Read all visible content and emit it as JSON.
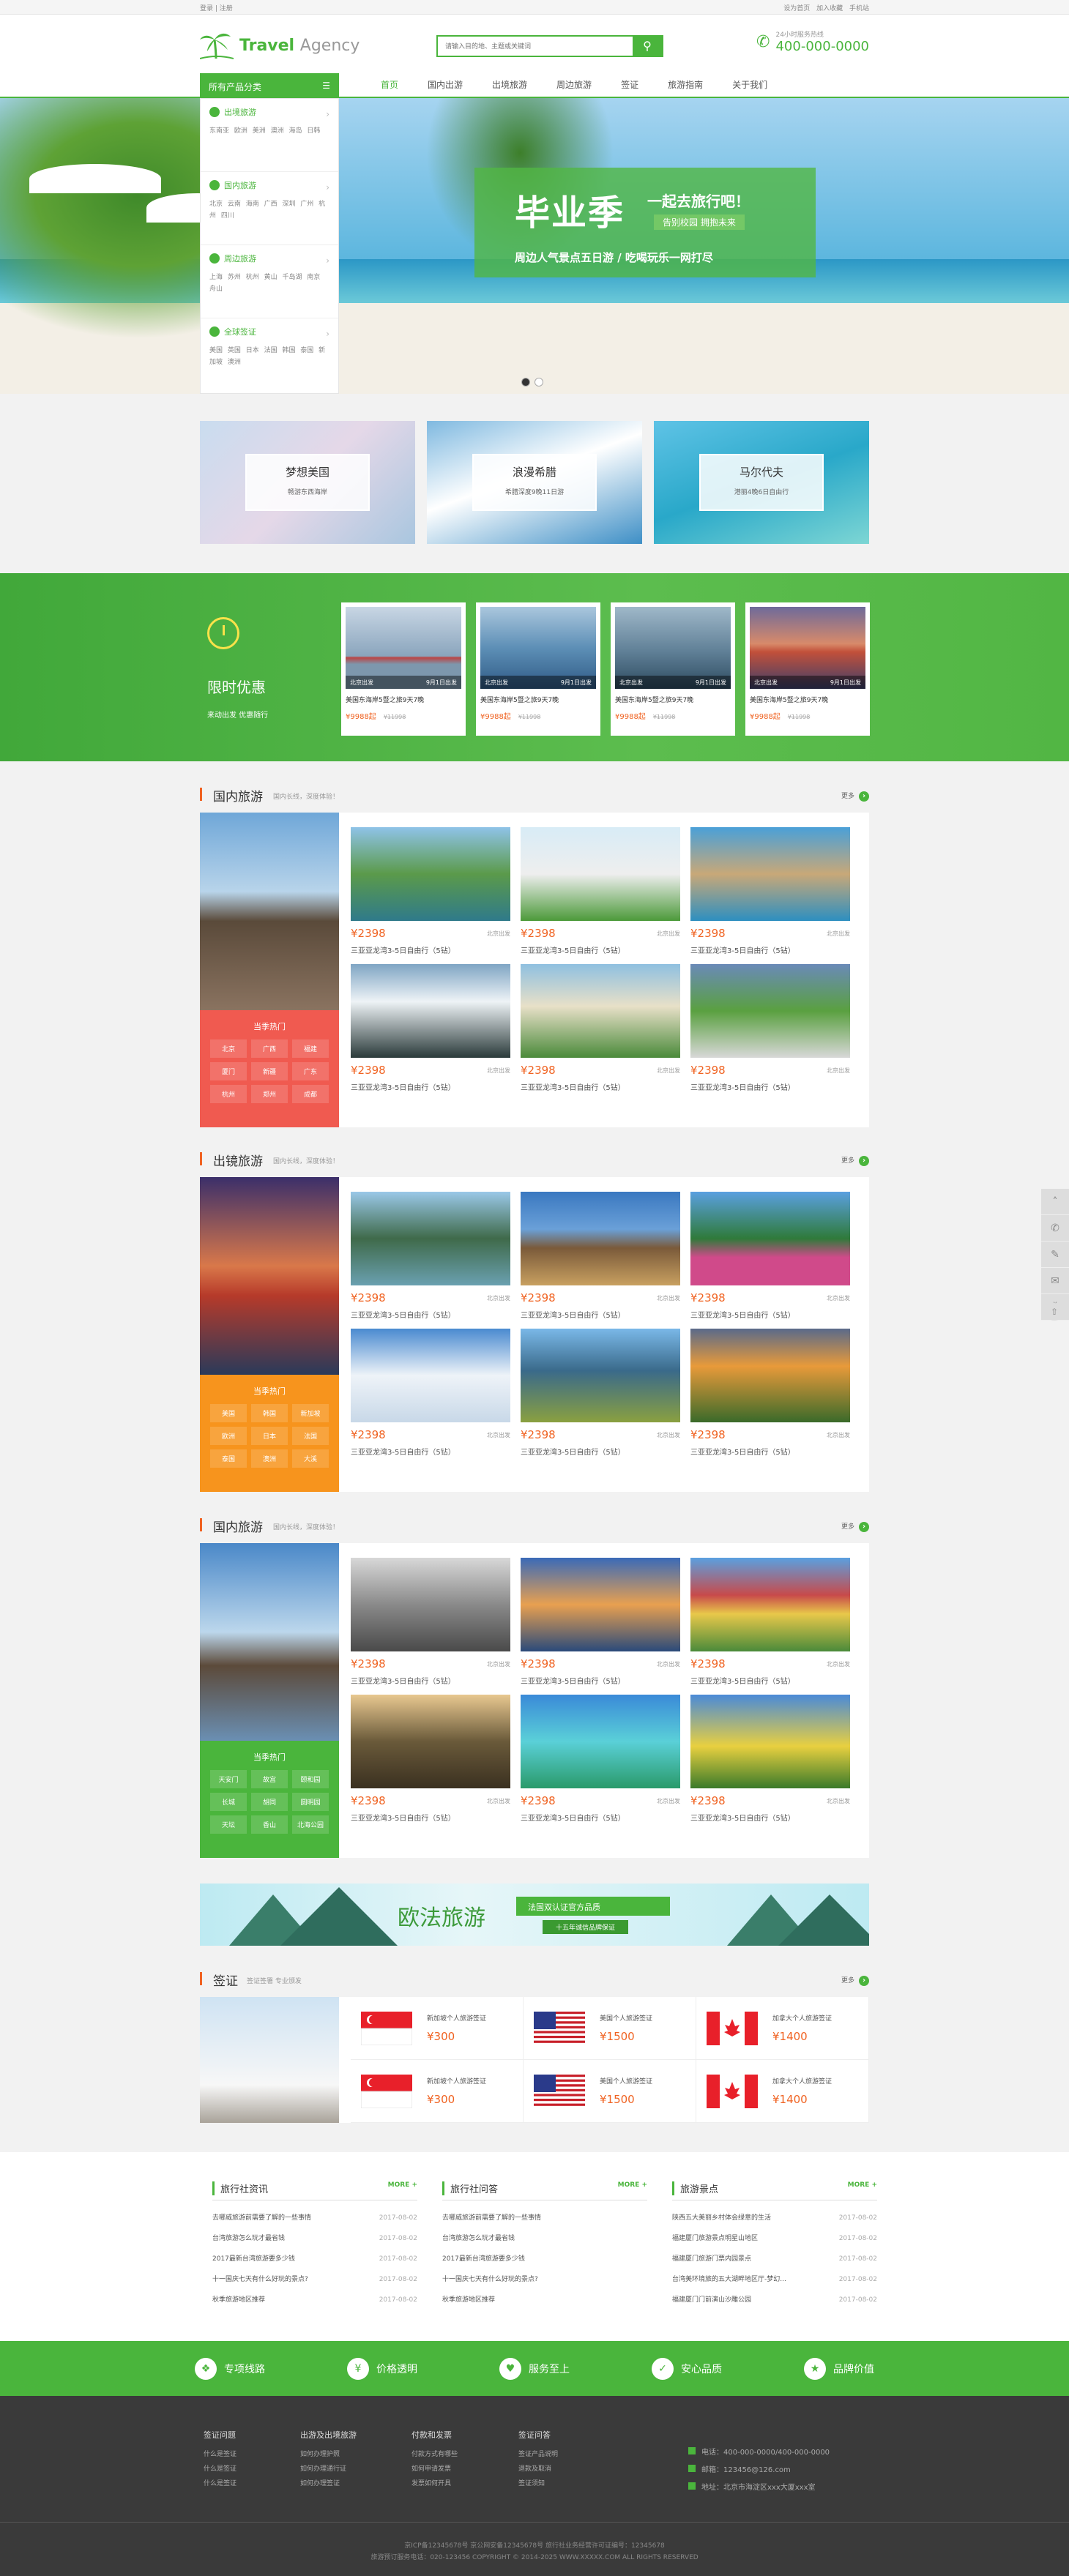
{
  "topbar": {
    "left": "登录 | 注册",
    "right": "设为首页 加入收藏 手机站"
  },
  "header": {
    "logo": "Travel",
    "logo2": "Agency",
    "search_placeholder": "请输入目的地、主题或关键词",
    "hotline_label": "24小时服务热线",
    "hotline": "400-000-0000"
  },
  "nav": {
    "category": "所有产品分类",
    "items": [
      "首页",
      "国内出游",
      "出境旅游",
      "周边旅游",
      "签证",
      "旅游指南",
      "关于我们"
    ]
  },
  "catmenu": [
    {
      "title": "出境旅游",
      "links": "东南亚 欧洲 美洲 澳洲 海岛 日韩"
    },
    {
      "title": "国内旅游",
      "links": "北京 云南 海南 广西 深圳 广州 杭州 四川"
    },
    {
      "title": "周边旅游",
      "links": "上海 苏州 杭州 黄山 千岛湖 南京 舟山"
    },
    {
      "title": "全球签证",
      "links": "美国 英国 日本 法国 韩国 泰国 新加坡 澳洲"
    }
  ],
  "banner": {
    "big": "毕业季",
    "t1": "一起去旅行吧！",
    "t2": "告别校园 拥抱未来",
    "t3": "周边人气景点五日游 / 吃喝玩乐一网打尽"
  },
  "features": [
    {
      "title": "梦想美国",
      "sub": "畅游东西海岸"
    },
    {
      "title": "浪漫希腊",
      "sub": "希腊深度9晚11日游"
    },
    {
      "title": "马尔代夫",
      "sub": "港丽4晚6日自由行"
    }
  ],
  "deal": {
    "title": "限时优惠",
    "sub": "来动出发 优惠随行",
    "cards": [
      {
        "from": "北京出发",
        "date": "9月1日出发",
        "desc": "美国东海岸5暨之旅9天7晚",
        "price": "¥9988起",
        "old": "¥11998"
      },
      {
        "from": "北京出发",
        "date": "9月1日出发",
        "desc": "美国东海岸5暨之旅9天7晚",
        "price": "¥9988起",
        "old": "¥11998"
      },
      {
        "from": "北京出发",
        "date": "9月1日出发",
        "desc": "美国东海岸5暨之旅9天7晚",
        "price": "¥9988起",
        "old": "¥11998"
      },
      {
        "from": "北京出发",
        "date": "9月1日出发",
        "desc": "美国东海岸5暨之旅9天7晚",
        "price": "¥9988起",
        "old": "¥11998"
      }
    ]
  },
  "sections": [
    {
      "title": "国内旅游",
      "sub": "国内长线，深度体验！",
      "more": "更多",
      "hot_title": "当季热门",
      "hot": [
        "北京",
        "广西",
        "福建",
        "厦门",
        "新疆",
        "广东",
        "杭州",
        "郑州",
        "成都"
      ],
      "items": [
        {
          "price": "¥2398",
          "city": "北京出发",
          "name": "三亚亚龙湾3-5日自由行（5钻）"
        },
        {
          "price": "¥2398",
          "city": "北京出发",
          "name": "三亚亚龙湾3-5日自由行（5钻）"
        },
        {
          "price": "¥2398",
          "city": "北京出发",
          "name": "三亚亚龙湾3-5日自由行（5钻）"
        },
        {
          "price": "¥2398",
          "city": "北京出发",
          "name": "三亚亚龙湾3-5日自由行（5钻）"
        },
        {
          "price": "¥2398",
          "city": "北京出发",
          "name": "三亚亚龙湾3-5日自由行（5钻）"
        },
        {
          "price": "¥2398",
          "city": "北京出发",
          "name": "三亚亚龙湾3-5日自由行（5钻）"
        }
      ]
    },
    {
      "title": "出镜旅游",
      "sub": "国内长线，深度体验！",
      "more": "更多",
      "hot_title": "当季热门",
      "hot": [
        "美国",
        "韩国",
        "新加坡",
        "欧洲",
        "日本",
        "法国",
        "泰国",
        "澳洲",
        "大溪"
      ],
      "items": [
        {
          "price": "¥2398",
          "city": "北京出发",
          "name": "三亚亚龙湾3-5日自由行（5钻）"
        },
        {
          "price": "¥2398",
          "city": "北京出发",
          "name": "三亚亚龙湾3-5日自由行（5钻）"
        },
        {
          "price": "¥2398",
          "city": "北京出发",
          "name": "三亚亚龙湾3-5日自由行（5钻）"
        },
        {
          "price": "¥2398",
          "city": "北京出发",
          "name": "三亚亚龙湾3-5日自由行（5钻）"
        },
        {
          "price": "¥2398",
          "city": "北京出发",
          "name": "三亚亚龙湾3-5日自由行（5钻）"
        },
        {
          "price": "¥2398",
          "city": "北京出发",
          "name": "三亚亚龙湾3-5日自由行（5钻）"
        }
      ]
    },
    {
      "title": "国内旅游",
      "sub": "国内长线，深度体验！",
      "more": "更多",
      "hot_title": "当季热门",
      "hot": [
        "天安门",
        "故宫",
        "颐和园",
        "长城",
        "胡同",
        "圆明园",
        "天坛",
        "香山",
        "北海公园"
      ],
      "items": [
        {
          "price": "¥2398",
          "city": "北京出发",
          "name": "三亚亚龙湾3-5日自由行（5钻）"
        },
        {
          "price": "¥2398",
          "city": "北京出发",
          "name": "三亚亚龙湾3-5日自由行（5钻）"
        },
        {
          "price": "¥2398",
          "city": "北京出发",
          "name": "三亚亚龙湾3-5日自由行（5钻）"
        },
        {
          "price": "¥2398",
          "city": "北京出发",
          "name": "三亚亚龙湾3-5日自由行（5钻）"
        },
        {
          "price": "¥2398",
          "city": "北京出发",
          "name": "三亚亚龙湾3-5日自由行（5钻）"
        },
        {
          "price": "¥2398",
          "city": "北京出发",
          "name": "三亚亚龙湾3-5日自由行（5钻）"
        }
      ]
    }
  ],
  "ad": {
    "t1": "欧法旅游",
    "t2": "法国双认证官方品质",
    "t3": "十五年诚信品牌保证"
  },
  "visa": {
    "title": "签证",
    "sub": "签证签署 专业颁发",
    "more": "更多",
    "items": [
      {
        "name": "新加坡个人旅游签证",
        "price": "¥300",
        "flag": "sg"
      },
      {
        "name": "美国个人旅游签证",
        "price": "¥1500",
        "flag": "us"
      },
      {
        "name": "加拿大个人旅游签证",
        "price": "¥1400",
        "flag": "ca"
      },
      {
        "name": "新加坡个人旅游签证",
        "price": "¥300",
        "flag": "sg"
      },
      {
        "name": "美国个人旅游签证",
        "price": "¥1500",
        "flag": "us"
      },
      {
        "name": "加拿大个人旅游签证",
        "price": "¥1400",
        "flag": "ca"
      }
    ]
  },
  "news": [
    {
      "title": "旅行社资讯",
      "more": "MORE +",
      "rows": [
        {
          "t": "去哪威旅游前需要了解的一些事情",
          "d": "2017-08-02"
        },
        {
          "t": "台湾旅游怎么玩才最省钱",
          "d": "2017-08-02"
        },
        {
          "t": "2017最新台湾旅游要多少钱",
          "d": "2017-08-02"
        },
        {
          "t": "十一国庆七天有什么好玩的景点?",
          "d": "2017-08-02"
        },
        {
          "t": "秋季旅游地区推荐",
          "d": "2017-08-02"
        }
      ]
    },
    {
      "title": "旅行社问答",
      "more": "MORE +",
      "rows": [
        {
          "t": "去哪威旅游前需要了解的一些事情",
          "d": ""
        },
        {
          "t": "台湾旅游怎么玩才最省钱",
          "d": ""
        },
        {
          "t": "2017最新台湾旅游要多少钱",
          "d": ""
        },
        {
          "t": "十一国庆七天有什么好玩的景点?",
          "d": ""
        },
        {
          "t": "秋季旅游地区推荐",
          "d": ""
        }
      ]
    },
    {
      "title": "旅游景点",
      "more": "MORE +",
      "rows": [
        {
          "t": "陕西五大美丽乡村体会绿意的生活",
          "d": "2017-08-02"
        },
        {
          "t": "福建厦门旅游景点明星山地区",
          "d": "2017-08-02"
        },
        {
          "t": "福建厦门旅游门票内园景点",
          "d": "2017-08-02"
        },
        {
          "t": "台湾美环境旅的五大湖畔地区厅-梦幻...",
          "d": "2017-08-02"
        },
        {
          "t": "福建厦门门前演山沙雕公园",
          "d": "2017-08-02"
        }
      ]
    }
  ],
  "services": [
    "专项线路",
    "价格透明",
    "服务至上",
    "安心品质",
    "品牌价值"
  ],
  "footer": {
    "cols": [
      {
        "h": "签证问题",
        "links": [
          "什么是签证",
          "什么是签证",
          "什么是签证"
        ]
      },
      {
        "h": "出游及出境旅游",
        "links": [
          "如何办理护照",
          "如何办理通行证",
          "如何办理签证"
        ]
      },
      {
        "h": "付款和发票",
        "links": [
          "付款方式有哪些",
          "如何申请发票",
          "发票如何开具"
        ]
      },
      {
        "h": "签证问答",
        "links": [
          "签证产品说明",
          "退款及取消",
          "签证须知"
        ]
      }
    ],
    "contact": [
      "电话：400-000-0000/400-000-0000",
      "邮箱：123456@126.com",
      "地址：北京市海淀区xxx大厦xxx室"
    ],
    "copy1": "京ICP备12345678号   京公网安备12345678号   旅行社业务经营许可证编号：12345678",
    "copy2": "旅游预订服务电话：020-123456   COPYRIGHT © 2014-2025 WWW.XXXXX.COM ALL RIGHTS RESERVED"
  }
}
